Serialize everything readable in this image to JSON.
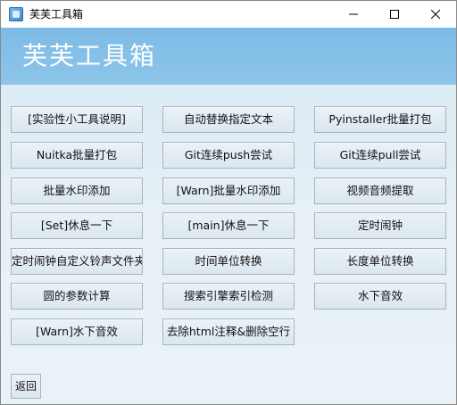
{
  "window": {
    "title": "芙芙工具箱",
    "icon": "app-icon",
    "controls": [
      "minimize-icon",
      "maximize-icon",
      "close-icon"
    ]
  },
  "header": {
    "title": "芙芙工具箱",
    "background_color": "#7cbbe6",
    "text_color": "#ffffff"
  },
  "tools": [
    "[实验性小工具说明]",
    "自动替换指定文本",
    "Pyinstaller批量打包",
    "Nuitka批量打包",
    "Git连续push尝试",
    "Git连续pull尝试",
    "批量水印添加",
    "[Warn]批量水印添加",
    "视频音频提取",
    "[Set]休息一下",
    "[main]休息一下",
    "定时闹钟",
    "定时闹钟自定义铃声文件夹",
    "时间单位转换",
    "长度单位转换",
    "圆的参数计算",
    "搜索引擎索引检测",
    "水下音效",
    "[Warn]水下音效",
    "去除html注释&删除空行"
  ],
  "footer": {
    "back_label": "返回"
  }
}
